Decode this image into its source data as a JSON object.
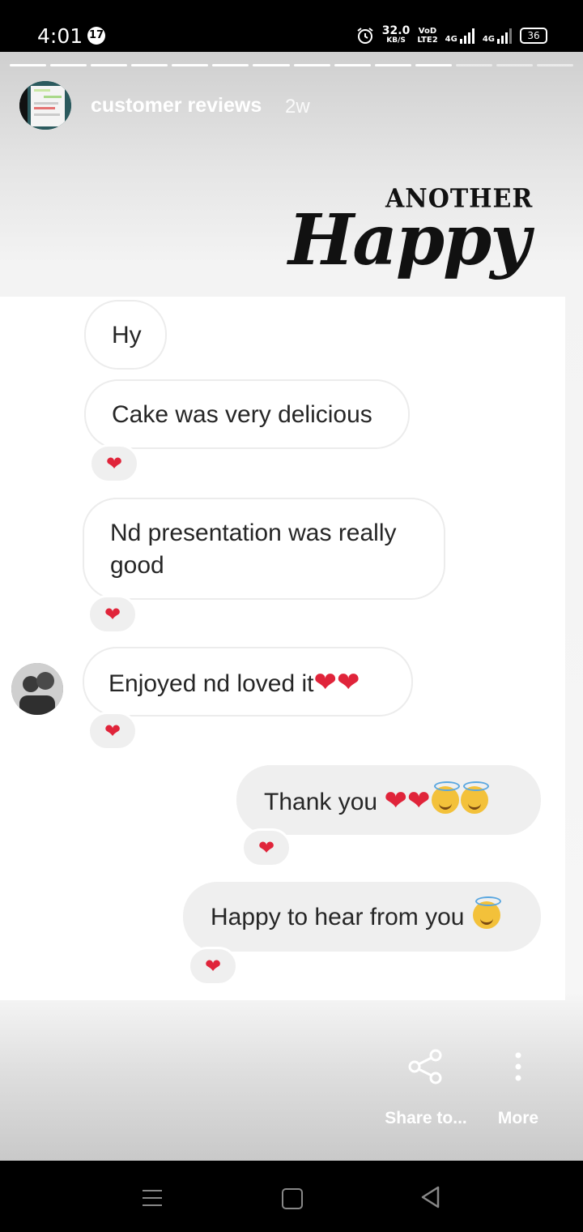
{
  "status_bar": {
    "time": "4:01",
    "notification_count": "17",
    "net_speed_value": "32.0",
    "net_speed_unit": "KB/S",
    "volte_top": "VoD",
    "volte_bottom": "LTE2",
    "signal1_label": "4G",
    "signal2_label": "4G",
    "battery": "36",
    "icons": [
      "alarm-icon",
      "signal-icon",
      "signal-icon",
      "battery-icon"
    ]
  },
  "story": {
    "progress_total": 14,
    "progress_done": 11,
    "username": "customer reviews",
    "age": "2w",
    "sticker": {
      "top": "ANOTHER",
      "bottom": "Happy"
    }
  },
  "chat": {
    "incoming": [
      {
        "text": "Hy"
      },
      {
        "text": "Cake was very delicious",
        "reaction": "heart"
      },
      {
        "text": "Nd presentation was really good",
        "reaction": "heart"
      },
      {
        "text": "Enjoyed nd loved it",
        "emoji": [
          "heart",
          "heart"
        ],
        "reaction": "heart"
      }
    ],
    "outgoing": [
      {
        "text": "Thank you",
        "emoji": [
          "heart",
          "heart",
          "halo-smile",
          "halo-smile"
        ],
        "reaction": "heart"
      },
      {
        "text": "Happy to hear from you",
        "emoji": [
          "halo-smile"
        ],
        "reaction": "heart"
      }
    ],
    "glyphs": {
      "heart": "❤"
    }
  },
  "actions": {
    "share_label": "Share to...",
    "more_label": "More"
  },
  "colors": {
    "heart": "#e0243a",
    "outgoing_bubble": "#efefef",
    "story_username": "#ffffff"
  }
}
